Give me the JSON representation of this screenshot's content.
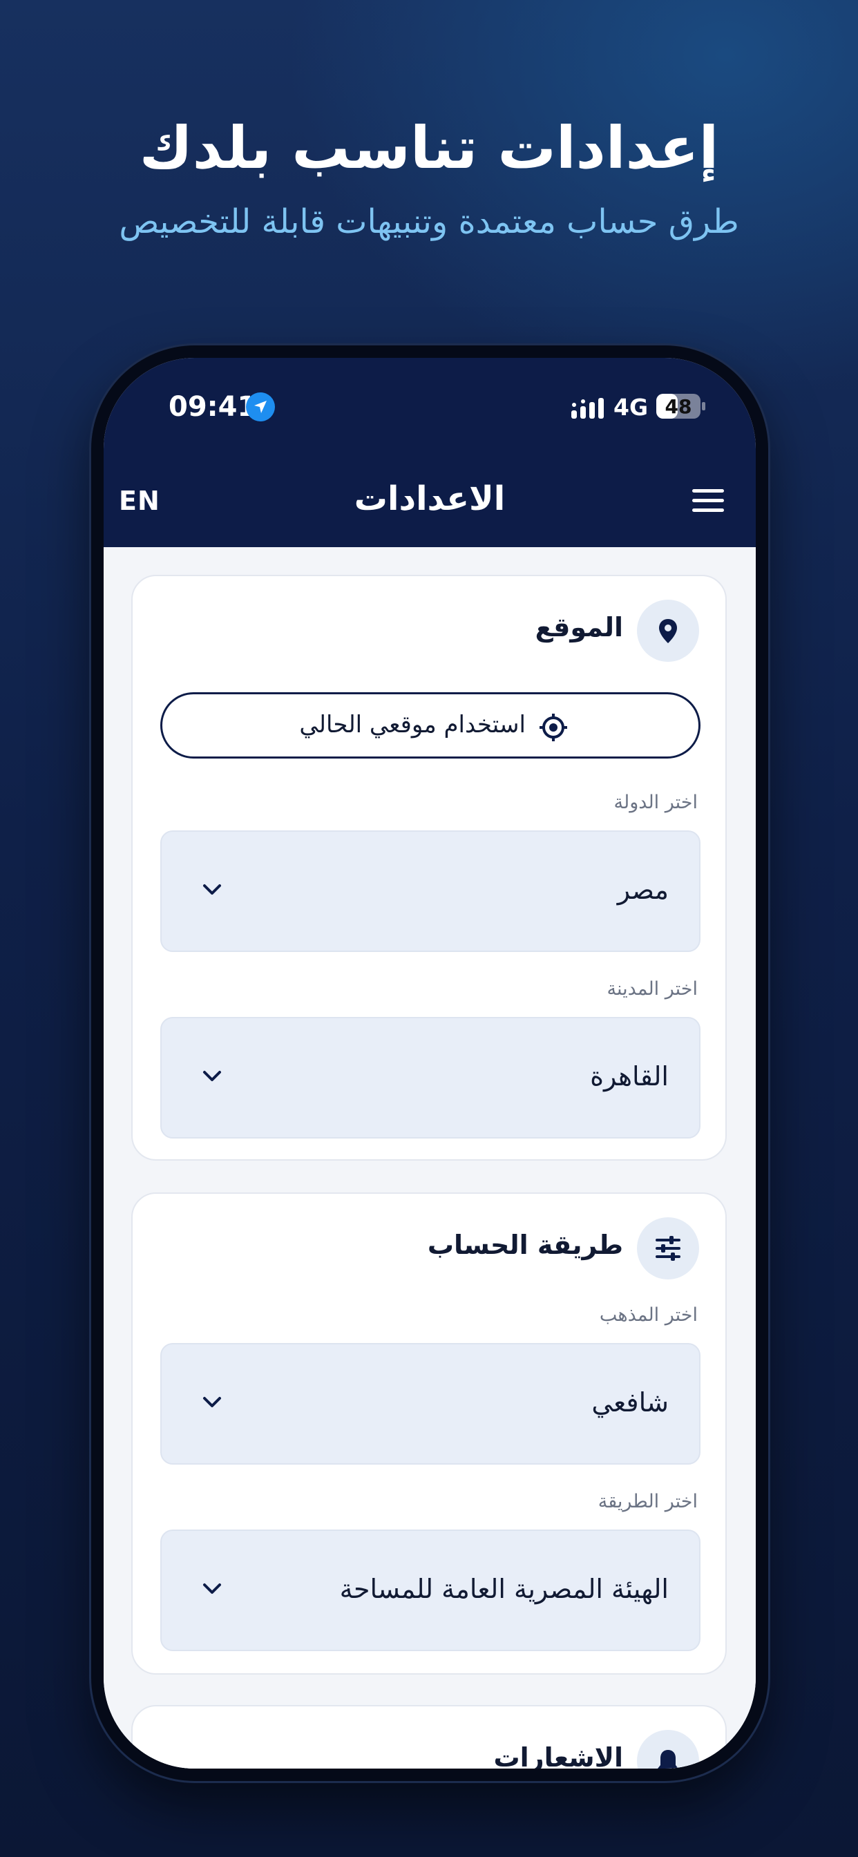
{
  "promo": {
    "title": "إعدادات تناسب بلدك",
    "subtitle": "طرق حساب معتمدة وتنبيهات قابلة للتخصيص"
  },
  "status_bar": {
    "time": "09:41",
    "network": "4G",
    "battery": "48",
    "battery_level": 0.48
  },
  "nav": {
    "lang_toggle": "EN",
    "title": "الاعدادات"
  },
  "location_card": {
    "title": "الموقع",
    "use_location_label": "استخدام موقعي الحالي",
    "country_label": "اختر الدولة",
    "country_value": "مصر",
    "city_label": "اختر المدينة",
    "city_value": "القاهرة"
  },
  "calculation_card": {
    "title": "طريقة الحساب",
    "madhab_label": "اختر المذهب",
    "madhab_value": "شافعي",
    "method_label": "اختر الطريقة",
    "method_value": "الهيئة المصرية العامة للمساحة"
  },
  "notifications_card": {
    "title": "الاشعارات"
  },
  "colors": {
    "primary": "#0d1c48",
    "accent_blue": "#1e8ef0",
    "subtitle": "#7ec4f2",
    "select_bg": "#e8eef8"
  },
  "icons": {
    "location_arrow": "location-arrow-icon",
    "signal": "signal-icon",
    "menu": "hamburger-menu-icon",
    "pin": "map-pin-icon",
    "crosshair": "crosshair-icon",
    "chevron": "chevron-down-icon",
    "sliders": "sliders-icon",
    "bell": "bell-icon"
  }
}
